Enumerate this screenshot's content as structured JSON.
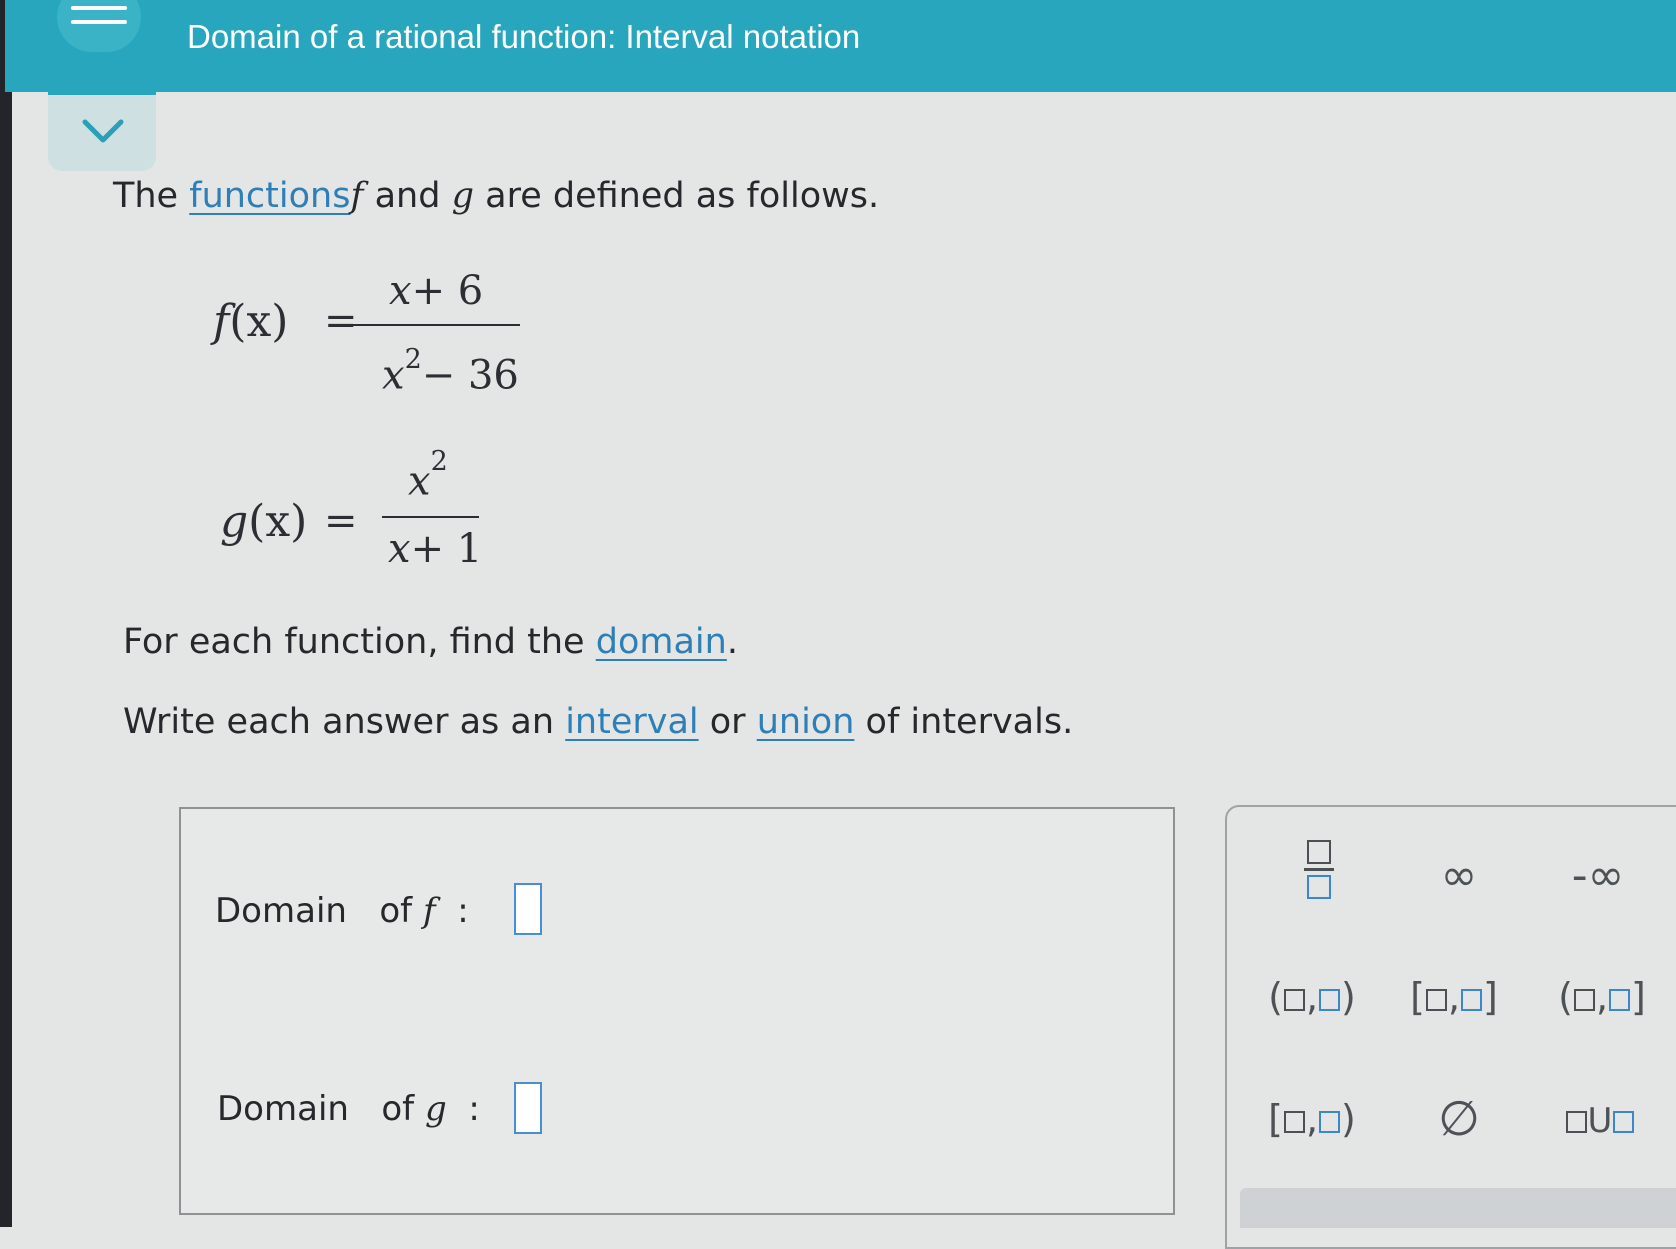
{
  "header": {
    "title": "Domain of a rational function: Interval notation"
  },
  "problem": {
    "intro_prefix": "The",
    "intro_link": "functions",
    "intro_f": "f",
    "intro_and": "and",
    "intro_g": "g",
    "intro_suffix": "are defined as follows.",
    "f_lhs_name": "f",
    "f_lhs_arg": "(x)",
    "equals": "=",
    "f_num_x": "x",
    "f_num_rest": "+ 6",
    "f_den_x": "x",
    "f_den_exp": "2",
    "f_den_rest": "− 36",
    "g_lhs_name": "g",
    "g_lhs_arg": "(x)",
    "g_num_x": "x",
    "g_num_exp": "2",
    "g_den_x": "x",
    "g_den_rest": "+ 1",
    "task_prefix": "For each function, find the",
    "task_link": "domain",
    "task_suffix": ".",
    "write_prefix": "Write each answer as an",
    "write_link1": "interval",
    "write_or": "or",
    "write_link2": "union",
    "write_suffix": "of intervals."
  },
  "answers": {
    "domain_f_label": "Domain",
    "domain_f_of": "of",
    "domain_f_var": "f",
    "domain_f_colon": ":",
    "domain_f_value": "",
    "domain_g_label": "Domain",
    "domain_g_of": "of",
    "domain_g_var": "g",
    "domain_g_colon": ":",
    "domain_g_value": ""
  },
  "palette": {
    "infinity": "∞",
    "neg_infinity": "-∞",
    "empty_set": "∅",
    "open_paren": "(",
    "close_paren": ")",
    "open_bracket": "[",
    "close_bracket": "]",
    "comma": ",",
    "union": "U"
  },
  "colors": {
    "header_bg": "#27a6bd",
    "link": "#2e7fb8",
    "input_border": "#4a8ed0"
  }
}
